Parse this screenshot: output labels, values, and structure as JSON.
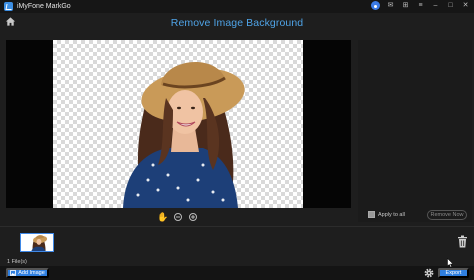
{
  "app": {
    "title": "iMyFone MarkGo"
  },
  "window_controls": [
    {
      "name": "user-icon"
    },
    {
      "name": "mail-icon",
      "glyph": "✉"
    },
    {
      "name": "gift-icon",
      "glyph": "⊞"
    },
    {
      "name": "menu-icon",
      "glyph": "≡"
    },
    {
      "name": "minimize-icon",
      "glyph": "–"
    },
    {
      "name": "maximize-icon",
      "glyph": "□"
    },
    {
      "name": "close-icon",
      "glyph": "✕"
    }
  ],
  "header": {
    "page_title": "Remove Image Background"
  },
  "panel": {
    "apply_label": "Apply to all",
    "apply_checked": false,
    "remove_button": "Remove Now"
  },
  "files": {
    "count_label": "1 File(s)"
  },
  "footer": {
    "add_button": "Add Image",
    "export_button": "Export"
  },
  "colors": {
    "accent": "#2f7fe0",
    "title_blue": "#4fa3e6",
    "background": "#1e1e1e",
    "preview_bg": "#050505"
  }
}
